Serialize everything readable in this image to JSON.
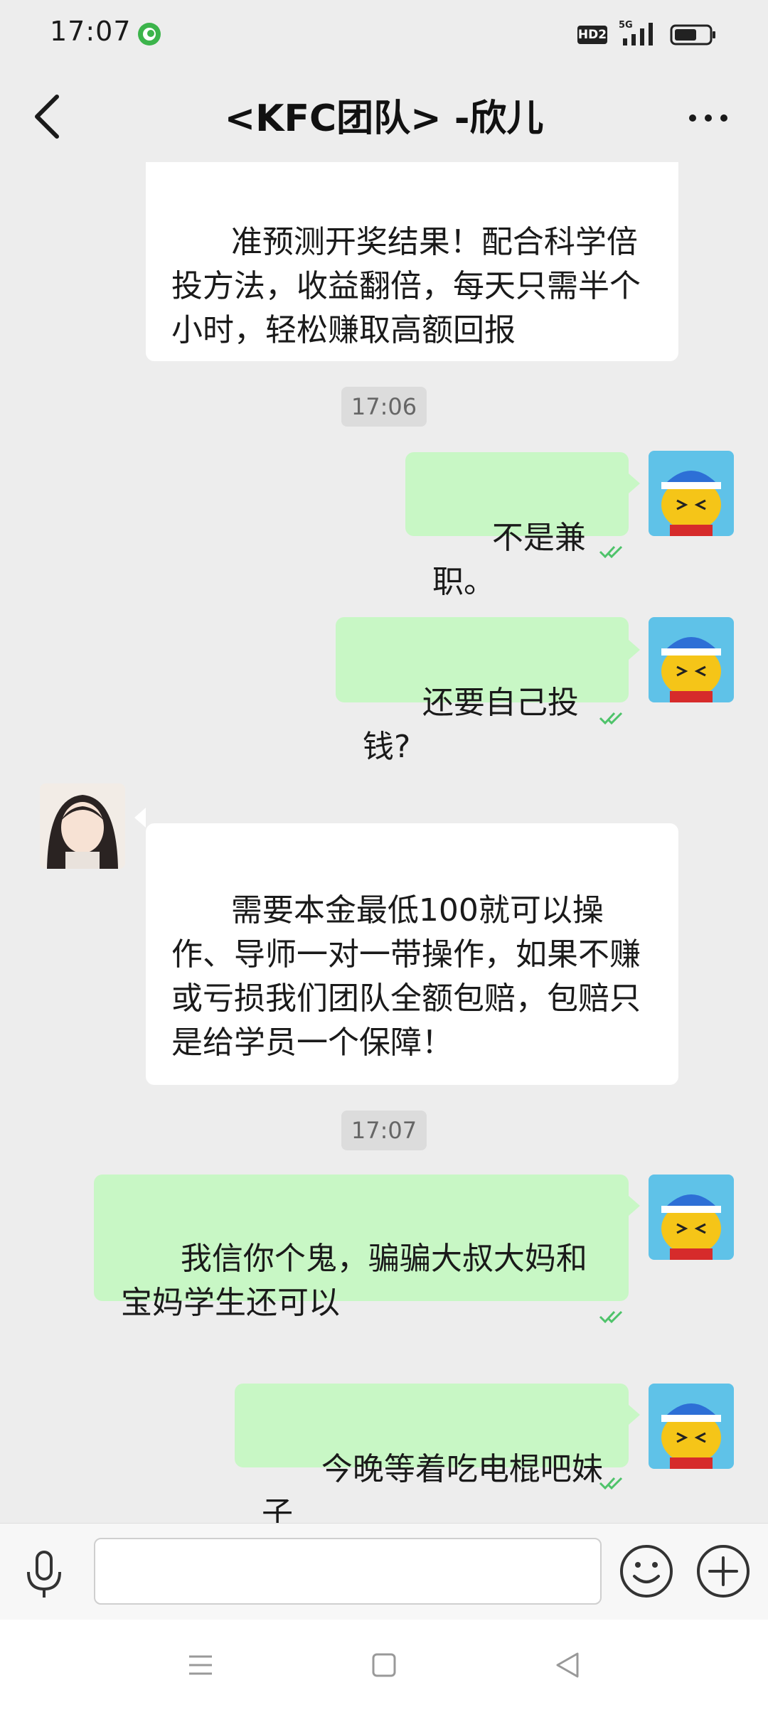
{
  "status_bar": {
    "time": "17:07",
    "hd_label": "HD2",
    "network_label": "5G"
  },
  "header": {
    "title": "<KFC团队> -欣儿"
  },
  "messages": [
    {
      "sender": "contact",
      "text": "准预测开奖结果！配合科学倍投方法，收益翻倍，每天只需半个小时，轻松赚取高额回报"
    },
    {
      "type": "timestamp",
      "text": "17:06"
    },
    {
      "sender": "me",
      "text": "不是兼职。",
      "read": true
    },
    {
      "sender": "me",
      "text": "还要自己投钱?",
      "read": true
    },
    {
      "sender": "contact",
      "text": "需要本金最低100就可以操作、导师一对一带操作，如果不赚或亏损我们团队全额包赔，包赔只是给学员一个保障！"
    },
    {
      "type": "timestamp",
      "text": "17:07"
    },
    {
      "sender": "me",
      "text": "我信你个鬼，骗骗大叔大妈和宝妈学生还可以",
      "read": true
    },
    {
      "sender": "me",
      "text": "今晚等着吃电棍吧妹子",
      "read": true
    }
  ],
  "input_bar": {
    "placeholder": ""
  },
  "colors": {
    "background": "#ededed",
    "outgoing_bubble": "#c8f7c5",
    "incoming_bubble": "#ffffff",
    "read_check": "#4ec36a"
  }
}
